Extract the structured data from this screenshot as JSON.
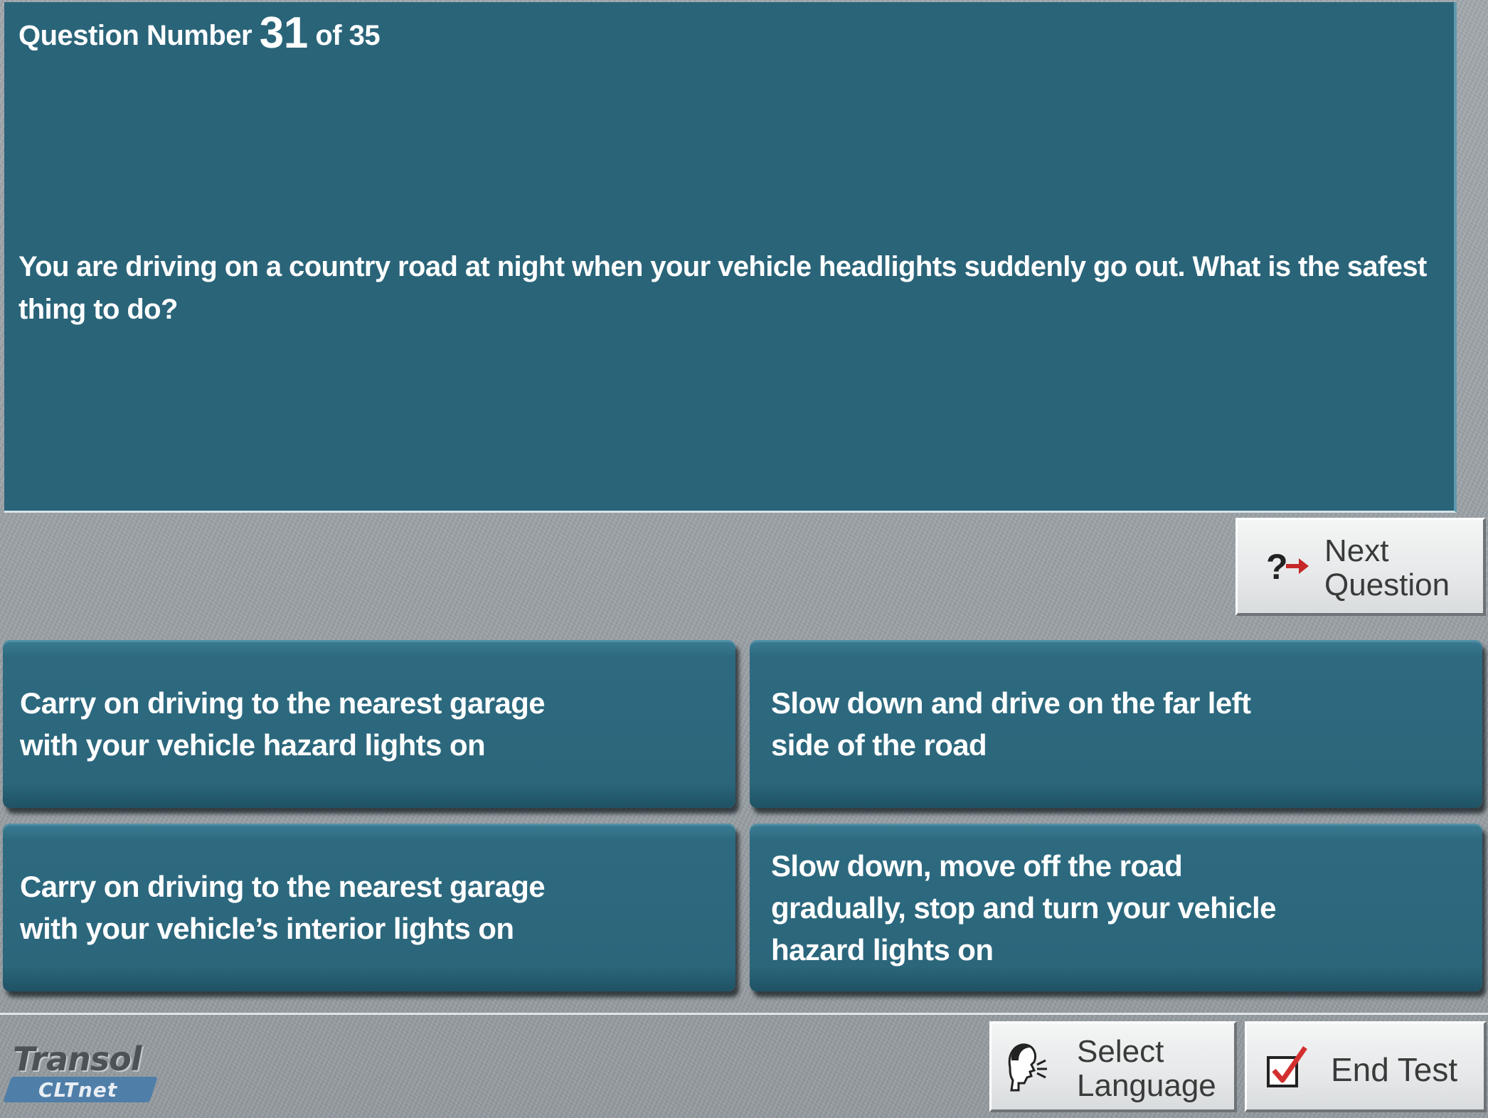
{
  "header": {
    "question_prefix": "Question Number",
    "question_number": "31",
    "question_total_text": "of 35"
  },
  "question": {
    "text": "You are driving on a country road at night when your vehicle headlights suddenly go out. What is the safest thing to do?"
  },
  "navigation": {
    "next_label_line1": "Next",
    "next_label_line2": "Question",
    "next_icon": "question-arrow-icon"
  },
  "answers": [
    {
      "text": "Carry on driving to the nearest garage\nwith your vehicle hazard lights on"
    },
    {
      "text": "Slow down and drive on the far left\nside of the road"
    },
    {
      "text": "Carry on driving to the nearest garage\nwith your vehicle’s interior lights on"
    },
    {
      "text": "Slow down, move off the road\ngradually, stop and turn your vehicle\nhazard lights on"
    }
  ],
  "footer": {
    "logo_main": "Transol",
    "logo_sub": "CLTnet",
    "select_language_line1": "Select",
    "select_language_line2": "Language",
    "select_language_icon": "speaking-head-icon",
    "end_test_label": "End Test",
    "end_test_icon": "checkbox-tick-icon"
  },
  "colors": {
    "panel_teal": "#2a6479",
    "stone_gray": "#9aa1a6",
    "arrow_red": "#c62828",
    "check_red": "#d32f2f"
  }
}
